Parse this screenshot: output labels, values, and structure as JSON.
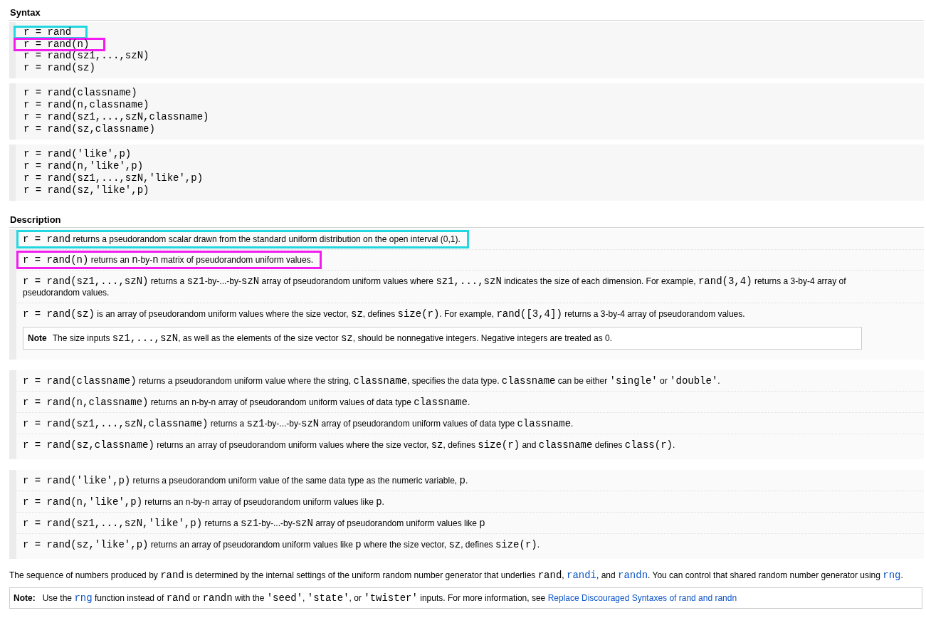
{
  "syntax": {
    "heading": "Syntax",
    "groups": [
      {
        "lines": [
          {
            "text": "r = rand",
            "color": "#22d8e0"
          },
          {
            "text": "r = rand(n)",
            "color": "#f01cf0"
          },
          {
            "text": "r = rand(sz1,...,szN)"
          },
          {
            "text": "r = rand(sz)"
          }
        ]
      },
      {
        "lines": [
          {
            "text": "r = rand(classname)"
          },
          {
            "text": "r = rand(n,classname)"
          },
          {
            "text": "r = rand(sz1,...,szN,classname)"
          },
          {
            "text": "r = rand(sz,classname)"
          }
        ]
      },
      {
        "lines": [
          {
            "text": "r = rand('like',p)"
          },
          {
            "text": "r = rand(n,'like',p)"
          },
          {
            "text": "r = rand(sz1,...,szN,'like',p)"
          },
          {
            "text": "r = rand(sz,'like',p)"
          }
        ]
      }
    ]
  },
  "description": {
    "heading": "Description",
    "groups": [
      {
        "items": [
          {
            "color": "#22d8e0",
            "segments": [
              {
                "kind": "code",
                "text": "r = rand"
              },
              {
                "kind": "text",
                "text": " returns a pseudorandom scalar drawn from the standard uniform distribution on the open interval (0,1)."
              }
            ]
          },
          {
            "color": "#f01cf0",
            "segments": [
              {
                "kind": "code",
                "text": "r = rand(n)"
              },
              {
                "kind": "text",
                "text": " returns an "
              },
              {
                "kind": "code",
                "text": "n"
              },
              {
                "kind": "text",
                "text": "-by-"
              },
              {
                "kind": "code",
                "text": "n"
              },
              {
                "kind": "text",
                "text": " matrix of pseudorandom uniform values."
              }
            ]
          },
          {
            "segments": [
              {
                "kind": "code",
                "text": "r = rand(sz1,...,szN)"
              },
              {
                "kind": "text",
                "text": " returns a "
              },
              {
                "kind": "code",
                "text": "sz1"
              },
              {
                "kind": "text",
                "text": "-by-...-by-"
              },
              {
                "kind": "code",
                "text": "szN"
              },
              {
                "kind": "text",
                "text": " array of pseudorandom uniform values where "
              },
              {
                "kind": "code",
                "text": "sz1,...,szN"
              },
              {
                "kind": "text",
                "text": " indicates the size of each dimension. For example, "
              },
              {
                "kind": "code",
                "text": "rand(3,4)"
              },
              {
                "kind": "text",
                "text": " returns a 3-by-4 array of pseudorandom values."
              }
            ]
          },
          {
            "segments": [
              {
                "kind": "code",
                "text": "r = rand(sz)"
              },
              {
                "kind": "text",
                "text": " is an array of pseudorandom uniform values where the size vector, "
              },
              {
                "kind": "code",
                "text": "sz"
              },
              {
                "kind": "text",
                "text": ", defines "
              },
              {
                "kind": "code",
                "text": "size(r)"
              },
              {
                "kind": "text",
                "text": ". For example, "
              },
              {
                "kind": "code",
                "text": "rand([3,4])"
              },
              {
                "kind": "text",
                "text": " returns a 3-by-4 array of pseudorandom values."
              }
            ]
          }
        ],
        "note": {
          "label": "Note",
          "segments": [
            {
              "kind": "text",
              "text": "The size inputs "
            },
            {
              "kind": "code",
              "text": "sz1,...,szN"
            },
            {
              "kind": "text",
              "text": ", as well as the elements of the size vector "
            },
            {
              "kind": "code",
              "text": "sz"
            },
            {
              "kind": "text",
              "text": ", should be nonnegative integers. Negative integers are treated as 0."
            }
          ]
        }
      },
      {
        "items": [
          {
            "segments": [
              {
                "kind": "code",
                "text": "r = rand(classname)"
              },
              {
                "kind": "text",
                "text": " returns a pseudorandom uniform value where the string, "
              },
              {
                "kind": "code",
                "text": "classname"
              },
              {
                "kind": "text",
                "text": ", specifies the data type. "
              },
              {
                "kind": "code",
                "text": "classname"
              },
              {
                "kind": "text",
                "text": " can be either "
              },
              {
                "kind": "code",
                "text": "'single'"
              },
              {
                "kind": "text",
                "text": " or "
              },
              {
                "kind": "code",
                "text": "'double'"
              },
              {
                "kind": "text",
                "text": "."
              }
            ]
          },
          {
            "segments": [
              {
                "kind": "code",
                "text": "r = rand(n,classname)"
              },
              {
                "kind": "text",
                "text": " returns an n-by-n array of pseudorandom uniform values of data type "
              },
              {
                "kind": "code",
                "text": "classname"
              },
              {
                "kind": "text",
                "text": "."
              }
            ]
          },
          {
            "segments": [
              {
                "kind": "code",
                "text": "r = rand(sz1,...,szN,classname)"
              },
              {
                "kind": "text",
                "text": " returns a "
              },
              {
                "kind": "code",
                "text": "sz1"
              },
              {
                "kind": "text",
                "text": "-by-...-by-"
              },
              {
                "kind": "code",
                "text": "szN"
              },
              {
                "kind": "text",
                "text": " array of pseudorandom uniform values of data type "
              },
              {
                "kind": "code",
                "text": "classname"
              },
              {
                "kind": "text",
                "text": "."
              }
            ]
          },
          {
            "segments": [
              {
                "kind": "code",
                "text": "r = rand(sz,classname)"
              },
              {
                "kind": "text",
                "text": " returns an array of pseudorandom uniform values where the size vector, "
              },
              {
                "kind": "code",
                "text": "sz"
              },
              {
                "kind": "text",
                "text": ", defines "
              },
              {
                "kind": "code",
                "text": "size(r)"
              },
              {
                "kind": "text",
                "text": " and "
              },
              {
                "kind": "code",
                "text": "classname"
              },
              {
                "kind": "text",
                "text": " defines "
              },
              {
                "kind": "code",
                "text": "class(r)"
              },
              {
                "kind": "text",
                "text": "."
              }
            ]
          }
        ]
      },
      {
        "items": [
          {
            "segments": [
              {
                "kind": "code",
                "text": "r = rand('like',p)"
              },
              {
                "kind": "text",
                "text": " returns a pseudorandom uniform value of the same data type as the numeric variable, "
              },
              {
                "kind": "code",
                "text": "p"
              },
              {
                "kind": "text",
                "text": "."
              }
            ]
          },
          {
            "segments": [
              {
                "kind": "code",
                "text": "r = rand(n,'like',p)"
              },
              {
                "kind": "text",
                "text": " returns an n-by-n array of pseudorandom uniform values like "
              },
              {
                "kind": "code",
                "text": "p"
              },
              {
                "kind": "text",
                "text": "."
              }
            ]
          },
          {
            "segments": [
              {
                "kind": "code",
                "text": "r = rand(sz1,...,szN,'like',p)"
              },
              {
                "kind": "text",
                "text": " returns a "
              },
              {
                "kind": "code",
                "text": "sz1"
              },
              {
                "kind": "text",
                "text": "-by-...-by-"
              },
              {
                "kind": "code",
                "text": "szN"
              },
              {
                "kind": "text",
                "text": " array of pseudorandom uniform values like "
              },
              {
                "kind": "code",
                "text": "p"
              }
            ]
          },
          {
            "segments": [
              {
                "kind": "code",
                "text": "r = rand(sz,'like',p)"
              },
              {
                "kind": "text",
                "text": " returns an array of pseudorandom uniform values like "
              },
              {
                "kind": "code",
                "text": "p"
              },
              {
                "kind": "text",
                "text": " where the size vector, "
              },
              {
                "kind": "code",
                "text": "sz"
              },
              {
                "kind": "text",
                "text": ", defines "
              },
              {
                "kind": "code",
                "text": "size(r)"
              },
              {
                "kind": "text",
                "text": "."
              }
            ]
          }
        ]
      }
    ]
  },
  "paragraph": {
    "segments": [
      {
        "kind": "text",
        "text": "The sequence of numbers produced by "
      },
      {
        "kind": "code",
        "text": "rand"
      },
      {
        "kind": "text",
        "text": " is determined by the internal settings of the uniform random number generator that underlies "
      },
      {
        "kind": "code",
        "text": "rand"
      },
      {
        "kind": "text",
        "text": ", "
      },
      {
        "kind": "code_link",
        "text": "randi"
      },
      {
        "kind": "text",
        "text": ", and "
      },
      {
        "kind": "code_link",
        "text": "randn"
      },
      {
        "kind": "text",
        "text": ". You can control that shared random number generator using "
      },
      {
        "kind": "code_link",
        "text": "rng"
      },
      {
        "kind": "text",
        "text": "."
      }
    ]
  },
  "note": {
    "label": "Note:",
    "segments": [
      {
        "kind": "text",
        "text": "Use the "
      },
      {
        "kind": "code_link",
        "text": "rng"
      },
      {
        "kind": "text",
        "text": " function instead of "
      },
      {
        "kind": "code",
        "text": "rand"
      },
      {
        "kind": "text",
        "text": " or "
      },
      {
        "kind": "code",
        "text": "randn"
      },
      {
        "kind": "text",
        "text": " with the "
      },
      {
        "kind": "code",
        "text": "'seed'"
      },
      {
        "kind": "text",
        "text": ", "
      },
      {
        "kind": "code",
        "text": "'state'"
      },
      {
        "kind": "text",
        "text": ", or "
      },
      {
        "kind": "code",
        "text": "'twister'"
      },
      {
        "kind": "text",
        "text": " inputs. For more information, see "
      },
      {
        "kind": "link",
        "text": "Replace Discouraged Syntaxes of rand and randn"
      }
    ]
  }
}
